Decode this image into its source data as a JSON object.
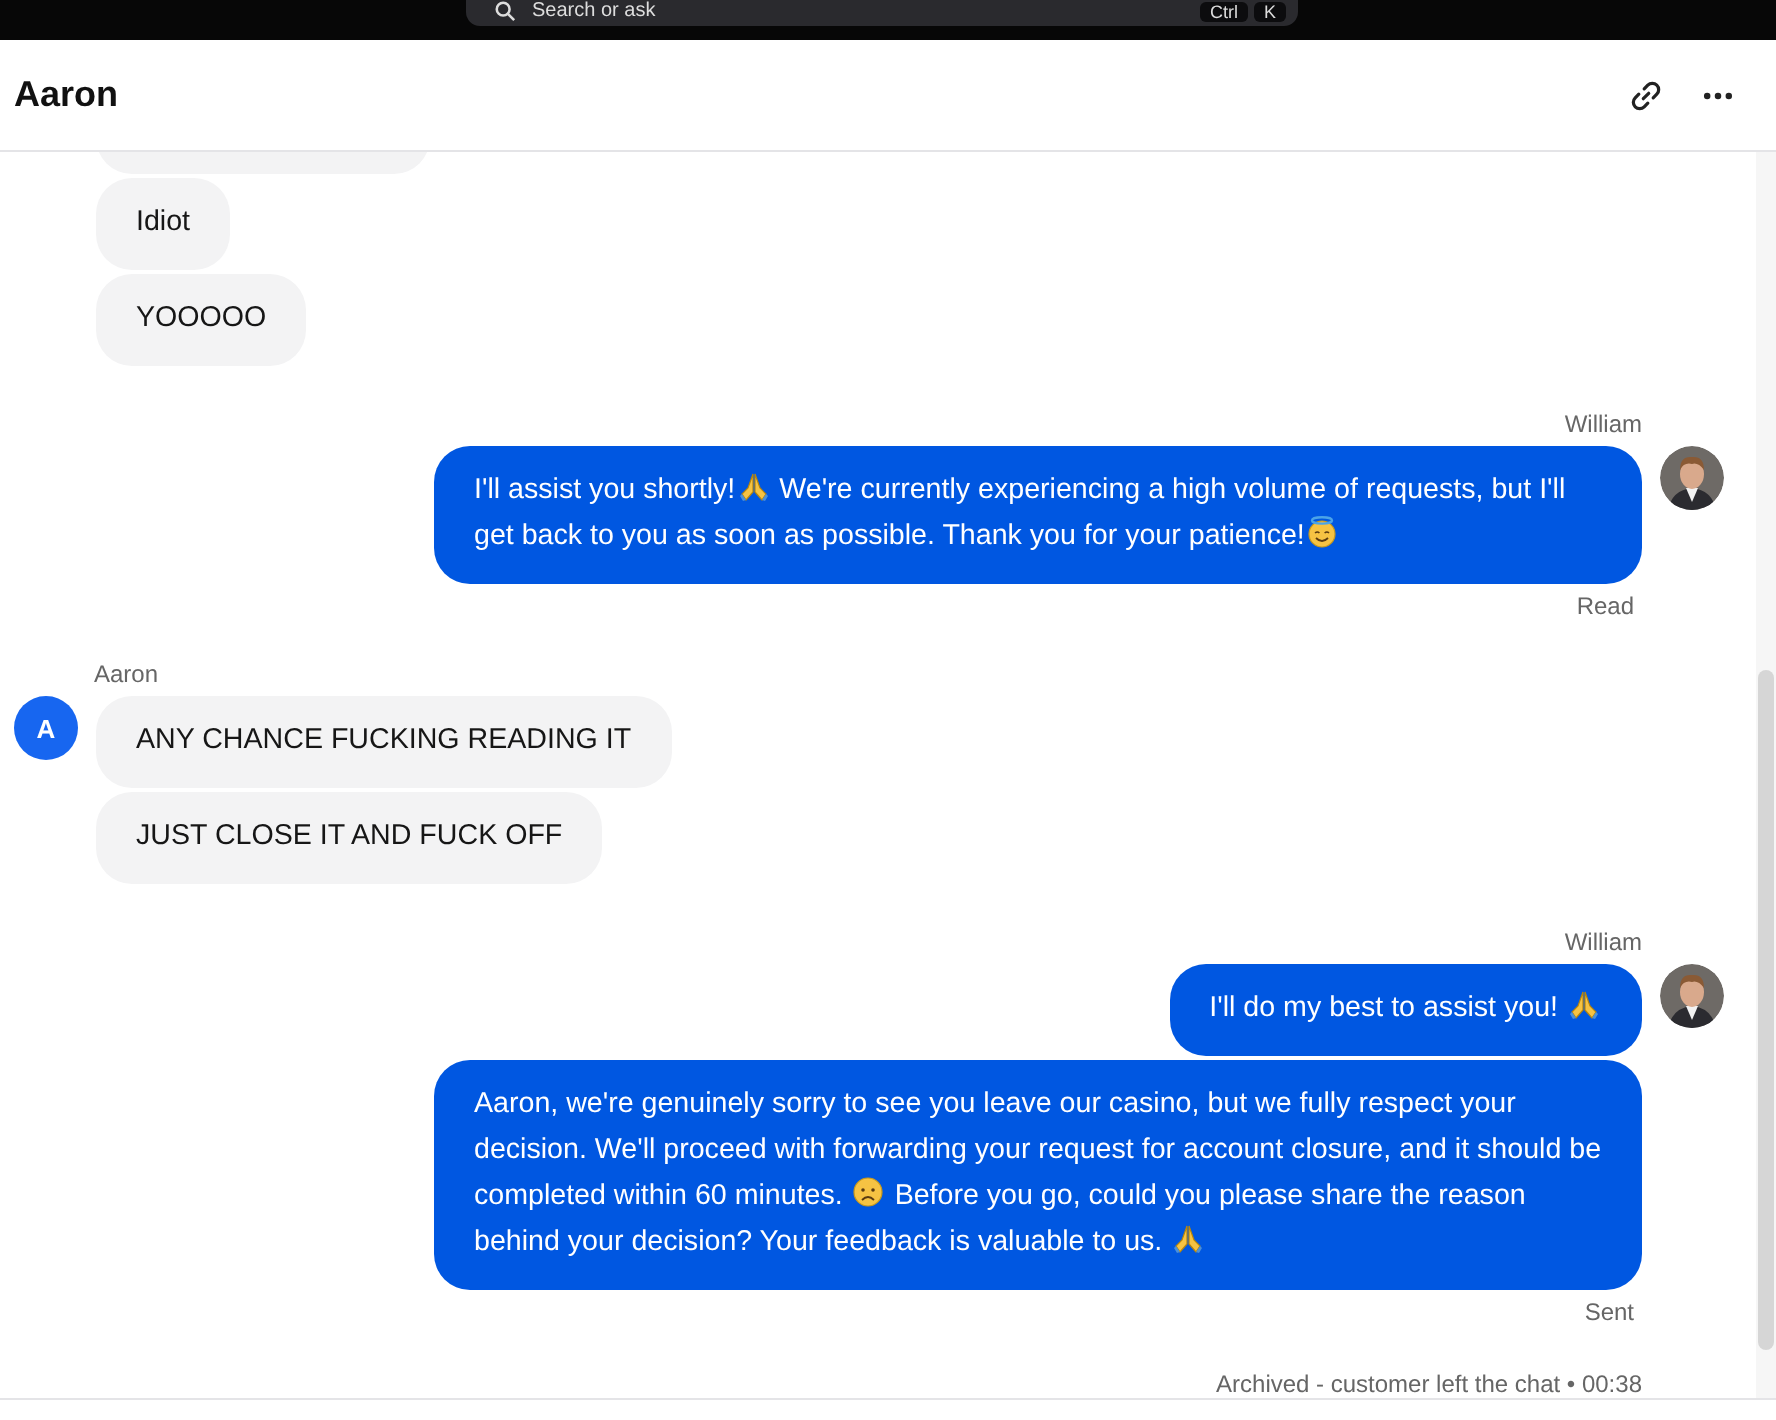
{
  "top_bar": {
    "search": {
      "placeholder": "Search or ask"
    },
    "shortcut": [
      "Ctrl",
      "K"
    ]
  },
  "header": {
    "title": "Aaron"
  },
  "groups": [
    {
      "kind": "left",
      "messages": [
        {
          "clipped": true
        },
        {
          "parts": [
            {
              "kind": "text",
              "text": "Idiot"
            }
          ]
        },
        {
          "parts": [
            {
              "kind": "text",
              "text": "YOOOOO"
            }
          ]
        }
      ]
    },
    {
      "kind": "right",
      "sender": "William",
      "avatar": {
        "kind": "picture"
      },
      "status": "Read",
      "messages": [
        {
          "parts": [
            {
              "kind": "text",
              "text": "I'll assist you shortly!"
            },
            {
              "kind": "pray"
            },
            {
              "kind": "text",
              "text": " We're currently experiencing a high volume of requests, but I'll get back to you as soon as possible. Thank you for your patience!"
            },
            {
              "kind": "halo"
            }
          ]
        }
      ]
    },
    {
      "kind": "left",
      "sender": "Aaron",
      "avatar": {
        "kind": "initial",
        "initial": "A"
      },
      "messages": [
        {
          "parts": [
            {
              "kind": "text",
              "text": "ANY CHANCE FUCKING READING IT"
            }
          ]
        },
        {
          "parts": [
            {
              "kind": "text",
              "text": "JUST CLOSE IT AND FUCK OFF"
            }
          ]
        }
      ]
    },
    {
      "kind": "right",
      "sender": "William",
      "avatar": {
        "kind": "picture"
      },
      "status": "Sent",
      "messages": [
        {
          "parts": [
            {
              "kind": "text",
              "text": "I'll do my best to assist you! "
            },
            {
              "kind": "pray"
            }
          ]
        },
        {
          "parts": [
            {
              "kind": "text",
              "text": "Aaron, we're genuinely sorry to see you leave our casino, but we fully respect your decision. We'll proceed with forwarding your request for account closure, and it should be completed within 60 minutes. "
            },
            {
              "kind": "sad"
            },
            {
              "kind": "text",
              "text": " Before you go, could you please share the reason behind your decision? Your feedback is valuable to us. "
            },
            {
              "kind": "pray"
            }
          ]
        }
      ]
    }
  ],
  "footer_note": "Archived - customer left the chat • 00:38"
}
